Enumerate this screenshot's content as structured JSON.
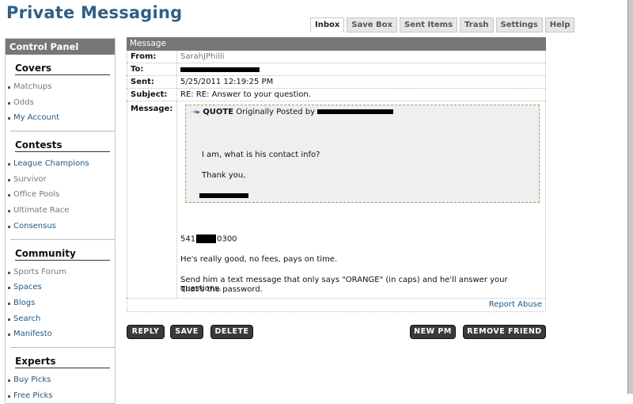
{
  "app": {
    "title": "Private Messaging"
  },
  "tabs": [
    "Inbox",
    "Save Box",
    "Sent Items",
    "Trash",
    "Settings",
    "Help"
  ],
  "sidebar": {
    "header": "Control Panel",
    "sections": [
      {
        "title": "Covers",
        "items": [
          {
            "label": "Matchups",
            "link": false
          },
          {
            "label": "Odds",
            "link": false
          },
          {
            "label": "My Account",
            "link": true
          }
        ]
      },
      {
        "title": "Contests",
        "items": [
          {
            "label": "League Champions",
            "link": true
          },
          {
            "label": "Survivor",
            "link": false
          },
          {
            "label": "Office Pools",
            "link": false
          },
          {
            "label": "Ultimate Race",
            "link": false
          },
          {
            "label": "Consensus",
            "link": true
          }
        ]
      },
      {
        "title": "Community",
        "items": [
          {
            "label": "Sports Forum",
            "link": false
          },
          {
            "label": "Spaces",
            "link": true
          },
          {
            "label": "Blogs",
            "link": true
          },
          {
            "label": "Search",
            "link": true
          },
          {
            "label": "Manifesto",
            "link": true
          }
        ]
      },
      {
        "title": "Experts",
        "items": [
          {
            "label": "Buy Picks",
            "link": true
          },
          {
            "label": "Free Picks",
            "link": true
          }
        ]
      }
    ]
  },
  "message": {
    "header": "Message",
    "from_label": "From:",
    "from": "SarahJPhilli",
    "to_label": "To:",
    "sent_label": "Sent:",
    "sent": "5/25/2011 12:19:25 PM",
    "subject_label": "Subject:",
    "subject": "RE: RE: Answer to your question.",
    "message_label": "Message:",
    "quote_keyword": "QUOTE",
    "quote_prefix": "Originally Posted by",
    "quote_line1": "I am, what is his contact info?",
    "quote_line2": "Thank you,",
    "phone_prefix": "541",
    "phone_suffix": "0300",
    "line1": "He's really good, no fees, pays on time.",
    "line2": "Send him a text message that only says \"ORANGE\" (in caps) and he'll answer your questions.",
    "line3": "That's the password.",
    "report_abuse": "Report Abuse"
  },
  "buttons": {
    "reply": "REPLY",
    "save": "SAVE",
    "delete": "DELETE",
    "new_pm": "NEW PM",
    "remove_friend": "REMOVE FRIEND"
  },
  "colors": {
    "title": "#2f5f86",
    "link": "#215a86",
    "panel_header": "#777777",
    "button": "#3a3a3a",
    "quote_bg": "#efefef"
  }
}
